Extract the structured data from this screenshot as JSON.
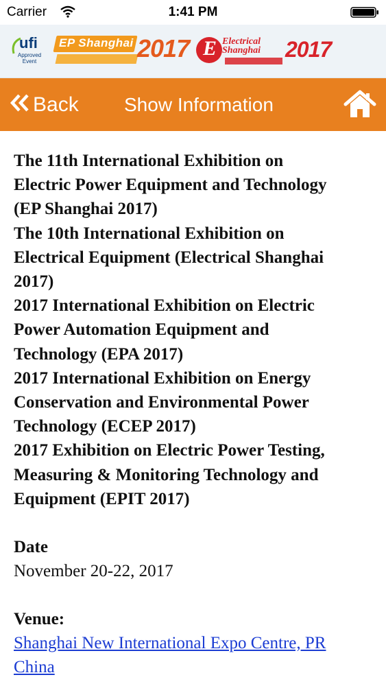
{
  "status_bar": {
    "carrier": "Carrier",
    "time": "1:41 PM",
    "icons": [
      "wifi-icon",
      "battery-icon"
    ]
  },
  "banner": {
    "ufi": {
      "text": "ufi",
      "sub": "Approved Event"
    },
    "ep": {
      "name": "EP Shanghai",
      "year": "2017"
    },
    "elec": {
      "name_line1": "Electrical",
      "name_line2": "Shanghai",
      "year": "2017",
      "mark": "E"
    }
  },
  "navbar": {
    "back_label": "Back",
    "title": "Show Information",
    "icons": [
      "double-chevron-left-icon",
      "home-icon"
    ],
    "color": "#e8801f"
  },
  "exhibitions": [
    {
      "lines": [
        "The 11th International Exhibition on",
        "Electric Power Equipment and Technology",
        "(EP Shanghai 2017)"
      ]
    },
    {
      "lines": [
        "The 10th International Exhibition on",
        "Electrical Equipment (Electrical Shanghai",
        "2017)"
      ]
    },
    {
      "lines": [
        "2017 International Exhibition on Electric",
        "Power Automation Equipment and",
        "Technology (EPA 2017)"
      ]
    },
    {
      "lines": [
        "2017 International Exhibition on Energy",
        "Conservation and Environmental Power",
        "Technology (ECEP 2017)"
      ]
    },
    {
      "lines": [
        "2017 Exhibition on Electric Power Testing,",
        "Measuring & Monitoring Technology and",
        "Equipment (EPIT 2017)"
      ]
    }
  ],
  "date": {
    "label": "Date",
    "value": "November 20-22, 2017"
  },
  "venue": {
    "label": "Venue:",
    "link_lines": [
      "Shanghai New International Expo Centre, PR",
      "China"
    ],
    "link_color": "#1b3cd3"
  }
}
